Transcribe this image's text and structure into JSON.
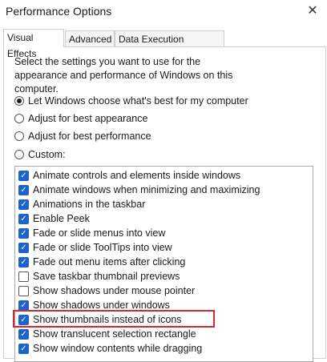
{
  "window": {
    "title": "Performance Options",
    "close_glyph": "✕"
  },
  "tabs": [
    {
      "label": "Visual Effects",
      "active": true
    },
    {
      "label": "Advanced",
      "active": false
    },
    {
      "label": "Data Execution Prevention",
      "active": false
    }
  ],
  "description": "Select the settings you want to use for the appearance and performance of Windows on this computer.",
  "options": [
    {
      "label": "Let Windows choose what's best for my computer",
      "selected": true
    },
    {
      "label": "Adjust for best appearance",
      "selected": false
    },
    {
      "label": "Adjust for best performance",
      "selected": false
    },
    {
      "label": "Custom:",
      "selected": false
    }
  ],
  "effects": [
    {
      "label": "Animate controls and elements inside windows",
      "checked": true
    },
    {
      "label": "Animate windows when minimizing and maximizing",
      "checked": true
    },
    {
      "label": "Animations in the taskbar",
      "checked": true
    },
    {
      "label": "Enable Peek",
      "checked": true
    },
    {
      "label": "Fade or slide menus into view",
      "checked": true
    },
    {
      "label": "Fade or slide ToolTips into view",
      "checked": true
    },
    {
      "label": "Fade out menu items after clicking",
      "checked": true
    },
    {
      "label": "Save taskbar thumbnail previews",
      "checked": false
    },
    {
      "label": "Show shadows under mouse pointer",
      "checked": false
    },
    {
      "label": "Show shadows under windows",
      "checked": true
    },
    {
      "label": "Show thumbnails instead of icons",
      "checked": true
    },
    {
      "label": "Show translucent selection rectangle",
      "checked": true
    },
    {
      "label": "Show window contents while dragging",
      "checked": true
    }
  ],
  "colors": {
    "checkbox_accent": "#1d63c9",
    "highlight_border": "#d2282e"
  },
  "highlighted_effect": "Show thumbnails instead of icons"
}
